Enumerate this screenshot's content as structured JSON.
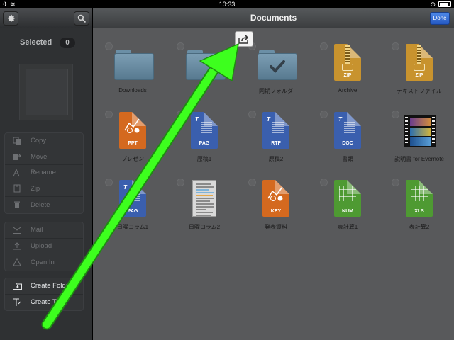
{
  "status_bar": {
    "time": "10:33",
    "left_glyphs": "✈ ≋"
  },
  "sidebar": {
    "selected_label": "Selected",
    "selected_count": "0",
    "groups": [
      [
        {
          "label": "Copy",
          "icon": "copy-icon"
        },
        {
          "label": "Move",
          "icon": "move-icon"
        },
        {
          "label": "Rename",
          "icon": "rename-icon"
        },
        {
          "label": "Zip",
          "icon": "zip-icon"
        },
        {
          "label": "Delete",
          "icon": "trash-icon"
        }
      ],
      [
        {
          "label": "Mail",
          "icon": "mail-icon"
        },
        {
          "label": "Upload",
          "icon": "upload-icon"
        },
        {
          "label": "Open In",
          "icon": "open-in-icon"
        }
      ],
      [
        {
          "label": "Create Folder",
          "icon": "create-folder-icon"
        },
        {
          "label": "Create Text",
          "icon": "create-text-icon"
        }
      ]
    ]
  },
  "header": {
    "title": "Documents",
    "done_label": "Done"
  },
  "files": [
    {
      "name": "Downloads",
      "kind": "folder"
    },
    {
      "name": "",
      "kind": "folder"
    },
    {
      "name": "同期フォルダ",
      "kind": "folder-check"
    },
    {
      "name": "Archive",
      "kind": "doc",
      "tag": "ZIP",
      "color": "#c8932e"
    },
    {
      "name": "テキストファイル",
      "kind": "doc",
      "tag": "ZIP",
      "color": "#c8932e"
    },
    {
      "name": "プレゼン",
      "kind": "doc",
      "tag": "PPT",
      "color": "#d4691f"
    },
    {
      "name": "原稿1",
      "kind": "doc",
      "tag": "PAG",
      "color": "#3a5fae"
    },
    {
      "name": "原稿2",
      "kind": "doc",
      "tag": "RTF",
      "color": "#3a5fae"
    },
    {
      "name": "書類",
      "kind": "doc",
      "tag": "DOC",
      "color": "#3a5fae"
    },
    {
      "name": "説明書 for Evernote",
      "kind": "film"
    },
    {
      "name": "日曜コラム1",
      "kind": "doc",
      "tag": "PAG",
      "color": "#3a5fae"
    },
    {
      "name": "日曜コラム2",
      "kind": "thumb"
    },
    {
      "name": "発表資料",
      "kind": "doc",
      "tag": "KEY",
      "color": "#d4691f"
    },
    {
      "name": "表計算1",
      "kind": "doc",
      "tag": "NUM",
      "color": "#4e9a32"
    },
    {
      "name": "表計算2",
      "kind": "doc",
      "tag": "XLS",
      "color": "#4e9a32"
    }
  ],
  "colors": {
    "annotation_arrow": "#3dff1e",
    "done_button": "#2f66d6"
  }
}
